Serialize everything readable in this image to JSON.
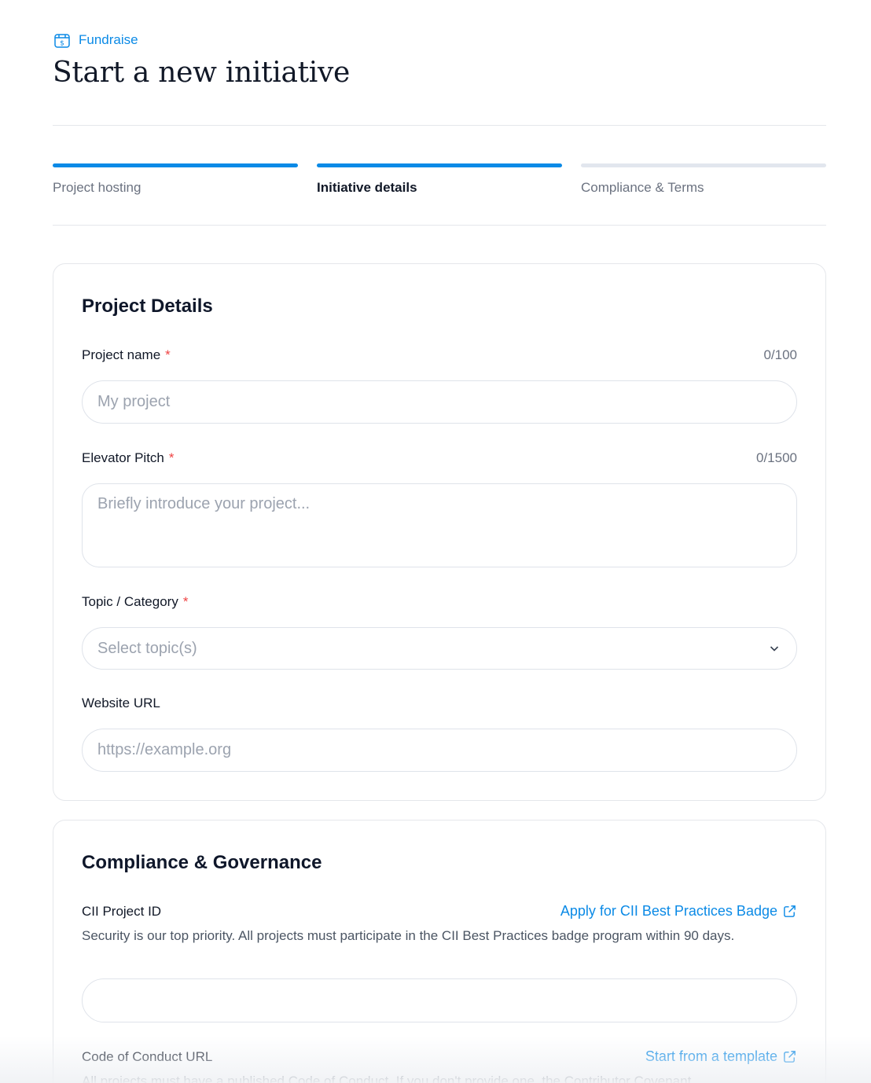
{
  "header": {
    "breadcrumb_icon": "fundraise-box-icon",
    "breadcrumb_label": "Fundraise",
    "title": "Start a new initiative"
  },
  "steps": [
    {
      "label": "Project hosting",
      "state": "done"
    },
    {
      "label": "Initiative details",
      "state": "active"
    },
    {
      "label": "Compliance & Terms",
      "state": "pending"
    }
  ],
  "project_details": {
    "title": "Project Details",
    "name": {
      "label": "Project name",
      "required": "*",
      "counter": "0/100",
      "placeholder": "My project",
      "value": ""
    },
    "pitch": {
      "label": "Elevator Pitch",
      "required": "*",
      "counter": "0/1500",
      "placeholder": "Briefly introduce your project...",
      "value": ""
    },
    "topic": {
      "label": "Topic / Category",
      "required": "*",
      "placeholder": "Select topic(s)"
    },
    "website": {
      "label": "Website URL",
      "placeholder": "https://example.org",
      "value": ""
    }
  },
  "compliance": {
    "title": "Compliance & Governance",
    "cii": {
      "label": "CII Project ID",
      "link": "Apply for CII Best Practices Badge",
      "help": "Security is our top priority. All projects must participate in the CII Best Practices badge program within 90 days.",
      "value": ""
    },
    "coc": {
      "label": "Code of Conduct URL",
      "link": "Start from a template",
      "help": "All projects must have a published Code of Conduct. If you don't provide one, the Contributor Covenant"
    }
  },
  "colors": {
    "accent": "#0b8ae6",
    "required": "#ef4444",
    "muted": "#6b7280"
  }
}
